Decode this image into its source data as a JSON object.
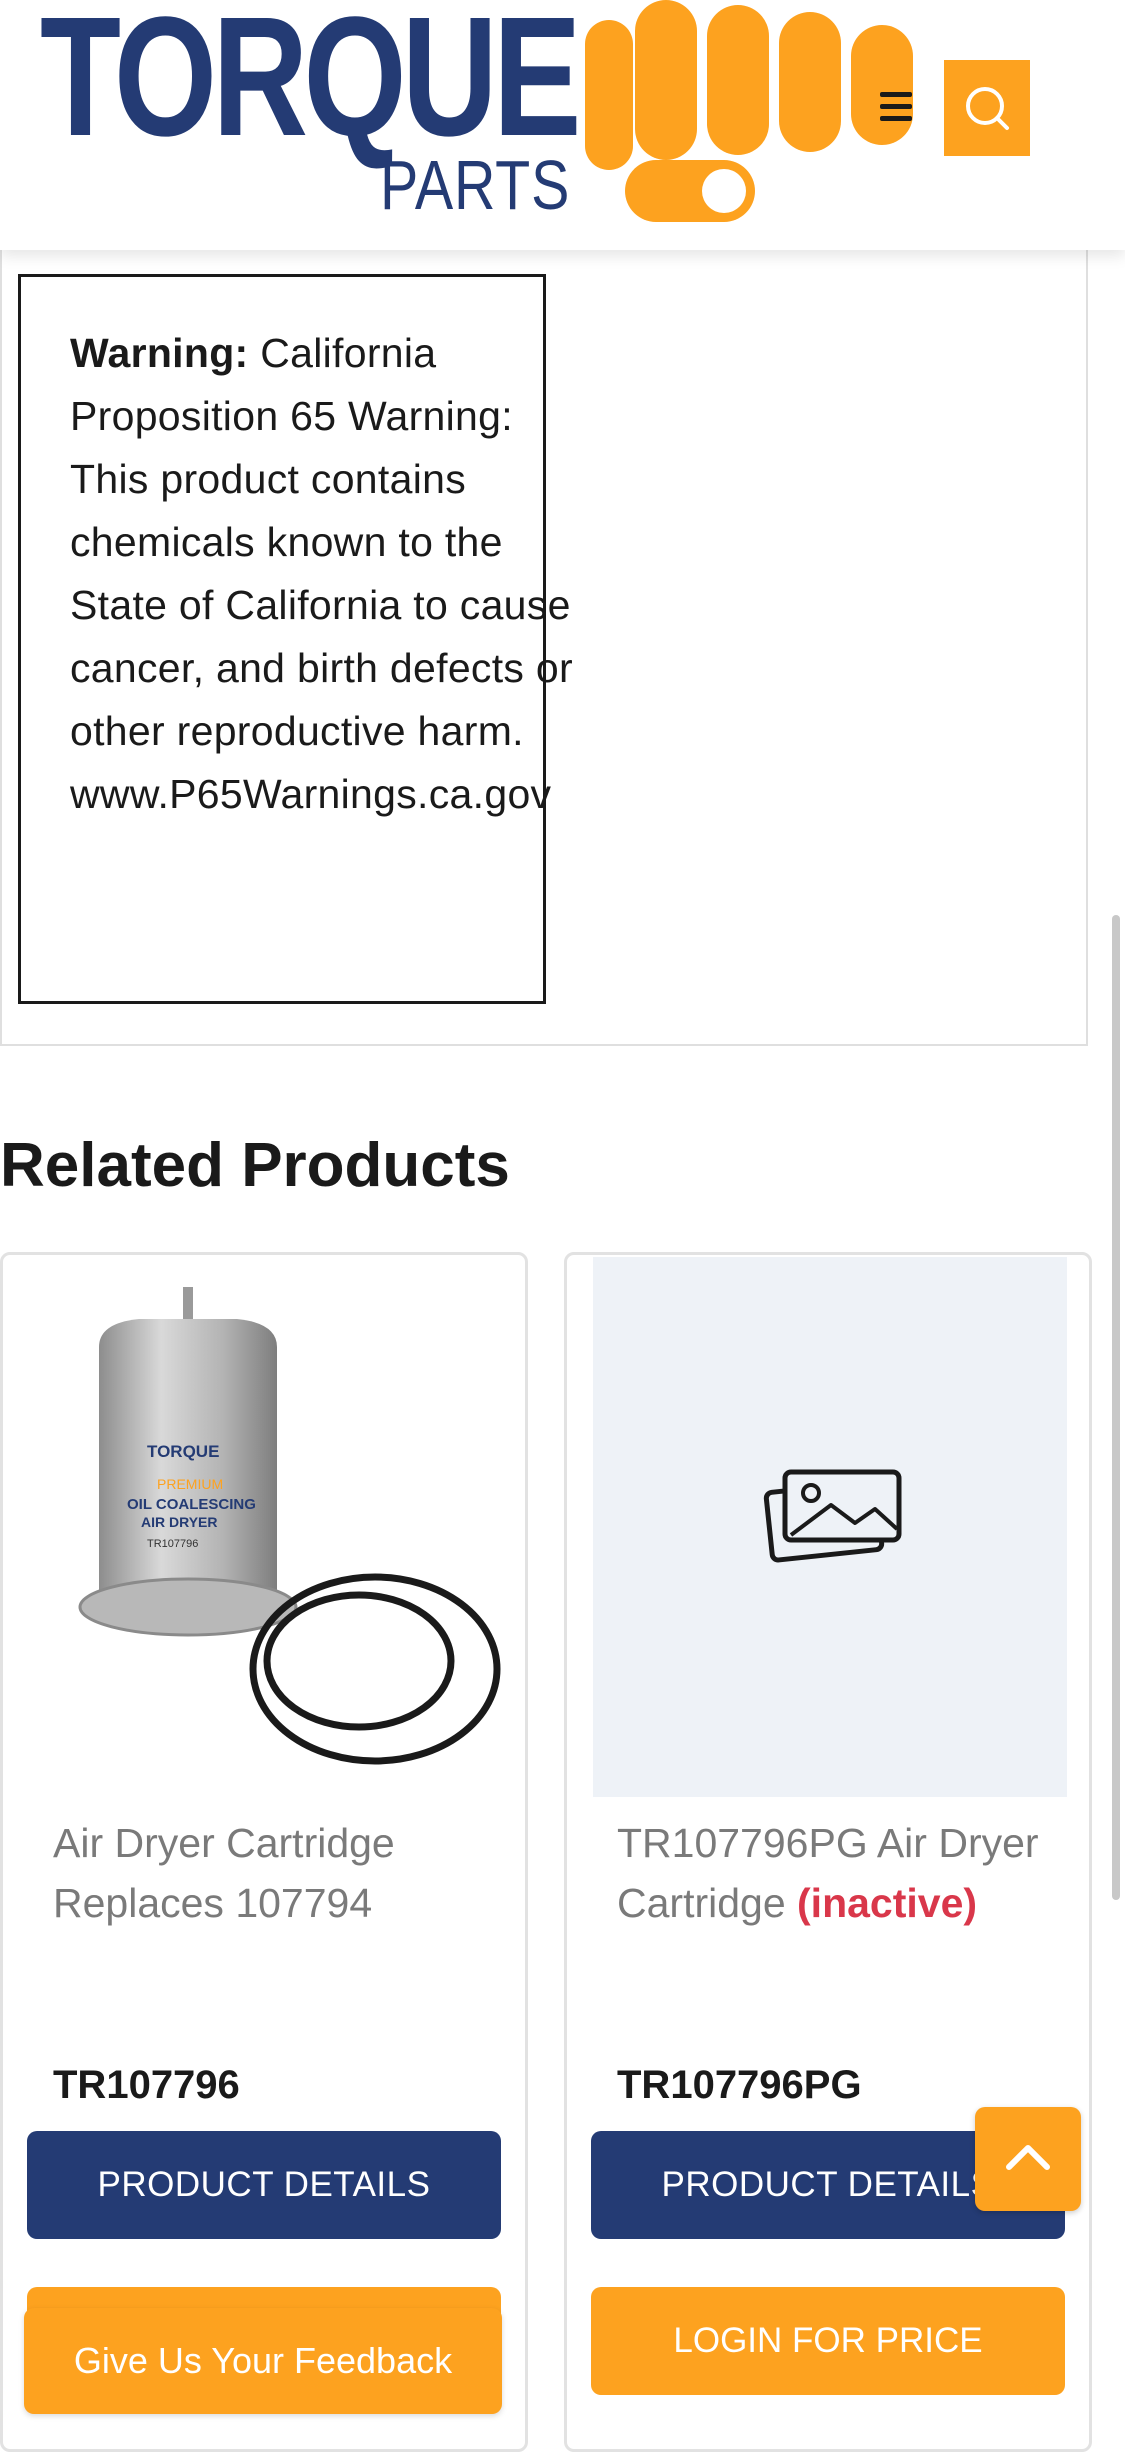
{
  "header": {
    "logo_main": "TORQUE",
    "logo_sub": "PARTS",
    "menu_icon": "hamburger-menu-icon",
    "search_icon": "search-icon",
    "accent_color": "#fda21f",
    "brand_color": "#243b74"
  },
  "warning": {
    "label": "Warning:",
    "text": "California Proposition 65 Warning: This product contains chemicals known to the State of California to cause cancer, and birth defects or other reproductive harm. www.P65Warnings.ca.gov"
  },
  "related": {
    "title": "Related Products",
    "products": [
      {
        "name": "Air Dryer Cartridge Replaces 107794",
        "status": "",
        "code": "TR107796",
        "details_label": "PRODUCT DETAILS",
        "image": "air-dryer-cartridge-photo",
        "image_text": {
          "brand": "TORQUE",
          "line1": "PREMIUM",
          "line2": "OIL COALESCING",
          "line3": "AIR DRYER",
          "code": "TR107796"
        }
      },
      {
        "name": "TR107796PG Air Dryer Cartridge",
        "status": "(inactive)",
        "code": "TR107796PG",
        "details_label": "PRODUCT DETAILS",
        "login_label": "LOGIN FOR PRICE",
        "image": "image-placeholder-icon"
      }
    ]
  },
  "feedback": {
    "label": "Give Us Your Feedback"
  },
  "scroll_top_icon": "chevron-up-icon"
}
